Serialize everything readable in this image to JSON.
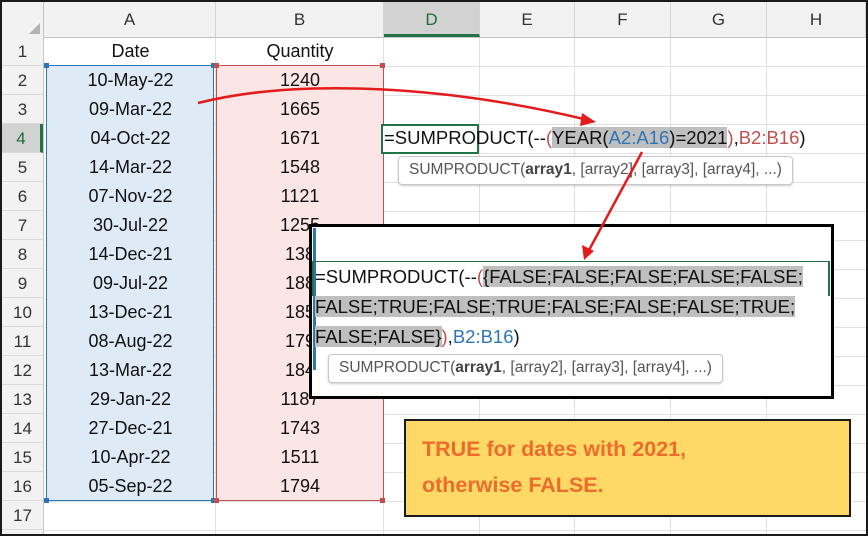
{
  "columns": [
    "A",
    "B",
    "D",
    "E",
    "F",
    "G",
    "H"
  ],
  "selected_column": "D",
  "rows": [
    "1",
    "2",
    "3",
    "4",
    "5",
    "6",
    "7",
    "8",
    "9",
    "10",
    "11",
    "12",
    "13",
    "14",
    "15",
    "16",
    "17"
  ],
  "selected_row": "4",
  "headers": {
    "date": "Date",
    "quantity": "Quantity"
  },
  "data_rows": [
    {
      "date": "10-May-22",
      "quantity": "1240"
    },
    {
      "date": "09-Mar-22",
      "quantity": "1665"
    },
    {
      "date": "04-Oct-22",
      "quantity": "1671"
    },
    {
      "date": "14-Mar-22",
      "quantity": "1548"
    },
    {
      "date": "07-Nov-22",
      "quantity": "1121"
    },
    {
      "date": "30-Jul-22",
      "quantity": "1255"
    },
    {
      "date": "14-Dec-21",
      "quantity": "138"
    },
    {
      "date": "09-Jul-22",
      "quantity": "188"
    },
    {
      "date": "13-Dec-21",
      "quantity": "185"
    },
    {
      "date": "08-Aug-22",
      "quantity": "179"
    },
    {
      "date": "13-Mar-22",
      "quantity": "184"
    },
    {
      "date": "29-Jan-22",
      "quantity": "1187"
    },
    {
      "date": "27-Dec-21",
      "quantity": "1743"
    },
    {
      "date": "10-Apr-22",
      "quantity": "1511"
    },
    {
      "date": "05-Sep-22",
      "quantity": "1794"
    }
  ],
  "formula": {
    "prefix": "=SUMPRODUCT(--",
    "open_paren": "(",
    "year_fn": "YEAR(",
    "year_ref": "A2:A16",
    "year_rest": ")=2021",
    "close_paren": ")",
    "comma": ",",
    "ref2": "B2:B16",
    "suffix": ")"
  },
  "tooltip": {
    "fn": "SUMPRODUCT(",
    "arg1": "array1",
    "rest": ", [array2], [array3], [array4], ...)"
  },
  "evaluated": {
    "prefix": "=SUMPRODUCT(--",
    "open_paren": "(",
    "line1_hl": "{FALSE;FALSE;FALSE;FALSE;FALSE;",
    "line2_hl": "FALSE;TRUE;FALSE;TRUE;FALSE;FALSE;FALSE;TRUE;",
    "line3_hl": "FALSE;FALSE}",
    "close_paren": ")",
    "comma": ",",
    "ref2": "B2:B16",
    "suffix": ")"
  },
  "note": {
    "line1": "TRUE for dates with 2021,",
    "line2": "otherwise FALSE."
  },
  "colors": {
    "range_a": "#2e75b6",
    "range_b": "#c0504d",
    "selection": "#217346",
    "arrow": "#e31b1b",
    "note_bg": "#ffd966",
    "note_text": "#ed6b2c"
  }
}
